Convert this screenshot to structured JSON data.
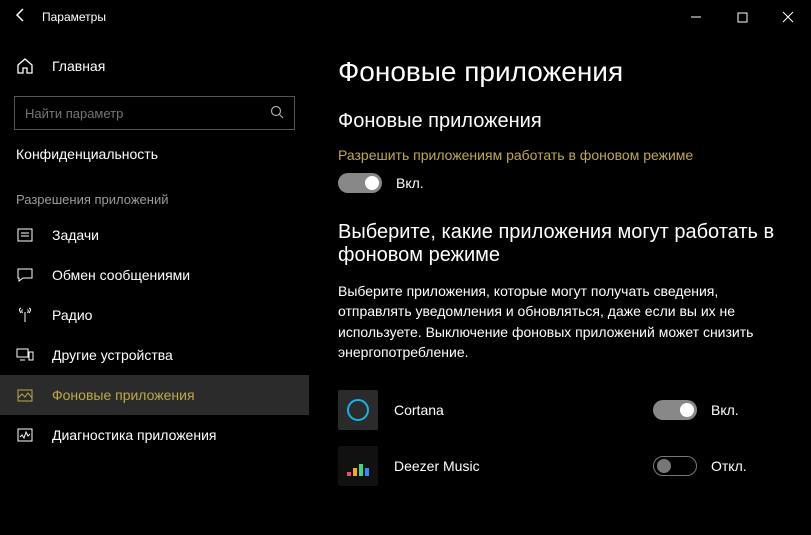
{
  "window": {
    "title": "Параметры"
  },
  "sidebar": {
    "home": "Главная",
    "search_placeholder": "Найти параметр",
    "category": "Конфиденциальность",
    "group_label": "Разрешения приложений",
    "items": [
      {
        "icon": "tasks",
        "label": "Задачи"
      },
      {
        "icon": "chat",
        "label": "Обмен сообщениями"
      },
      {
        "icon": "radio",
        "label": "Радио"
      },
      {
        "icon": "devices",
        "label": "Другие устройства"
      },
      {
        "icon": "background",
        "label": "Фоновые приложения",
        "active": true
      },
      {
        "icon": "diagnostics",
        "label": "Диагностика приложения"
      }
    ]
  },
  "content": {
    "page_title": "Фоновые приложения",
    "section1_title": "Фоновые приложения",
    "allow_text": "Разрешить приложениям работать в фоновом режиме",
    "on_label": "Вкл.",
    "off_label": "Откл.",
    "section2_title": "Выберите, какие приложения могут работать в фоновом режиме",
    "section2_desc": "Выберите приложения, которые могут получать сведения, отправлять уведомления и обновляться, даже если вы их не используете. Выключение фоновых приложений может снизить энергопотребление.",
    "apps": [
      {
        "name": "Cortana",
        "on": true
      },
      {
        "name": "Deezer Music",
        "on": false
      }
    ]
  }
}
